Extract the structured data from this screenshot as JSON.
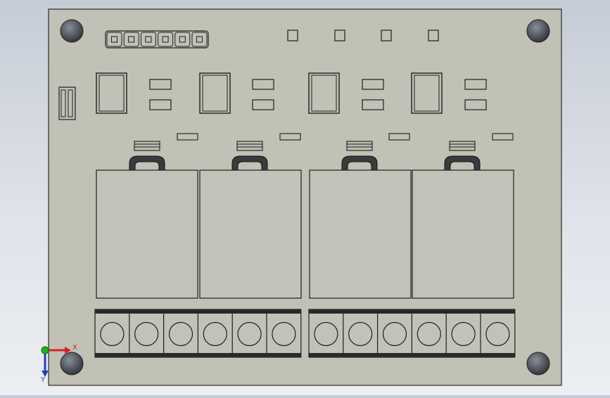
{
  "view": {
    "background_top": "#c6ccd6",
    "background_bottom": "#eceef2"
  },
  "board": {
    "fill": "#c2c1b6",
    "outline": "#2a2a2a",
    "mounting_holes": 4,
    "header_pins": 6,
    "test_pads": 4,
    "relay_channels": 4,
    "terminal_positions": 12
  },
  "triad": {
    "x_label": "X",
    "y_label": "Y",
    "x_color": "#d62020",
    "y_color": "#2040c0",
    "origin_color": "#18b418"
  }
}
